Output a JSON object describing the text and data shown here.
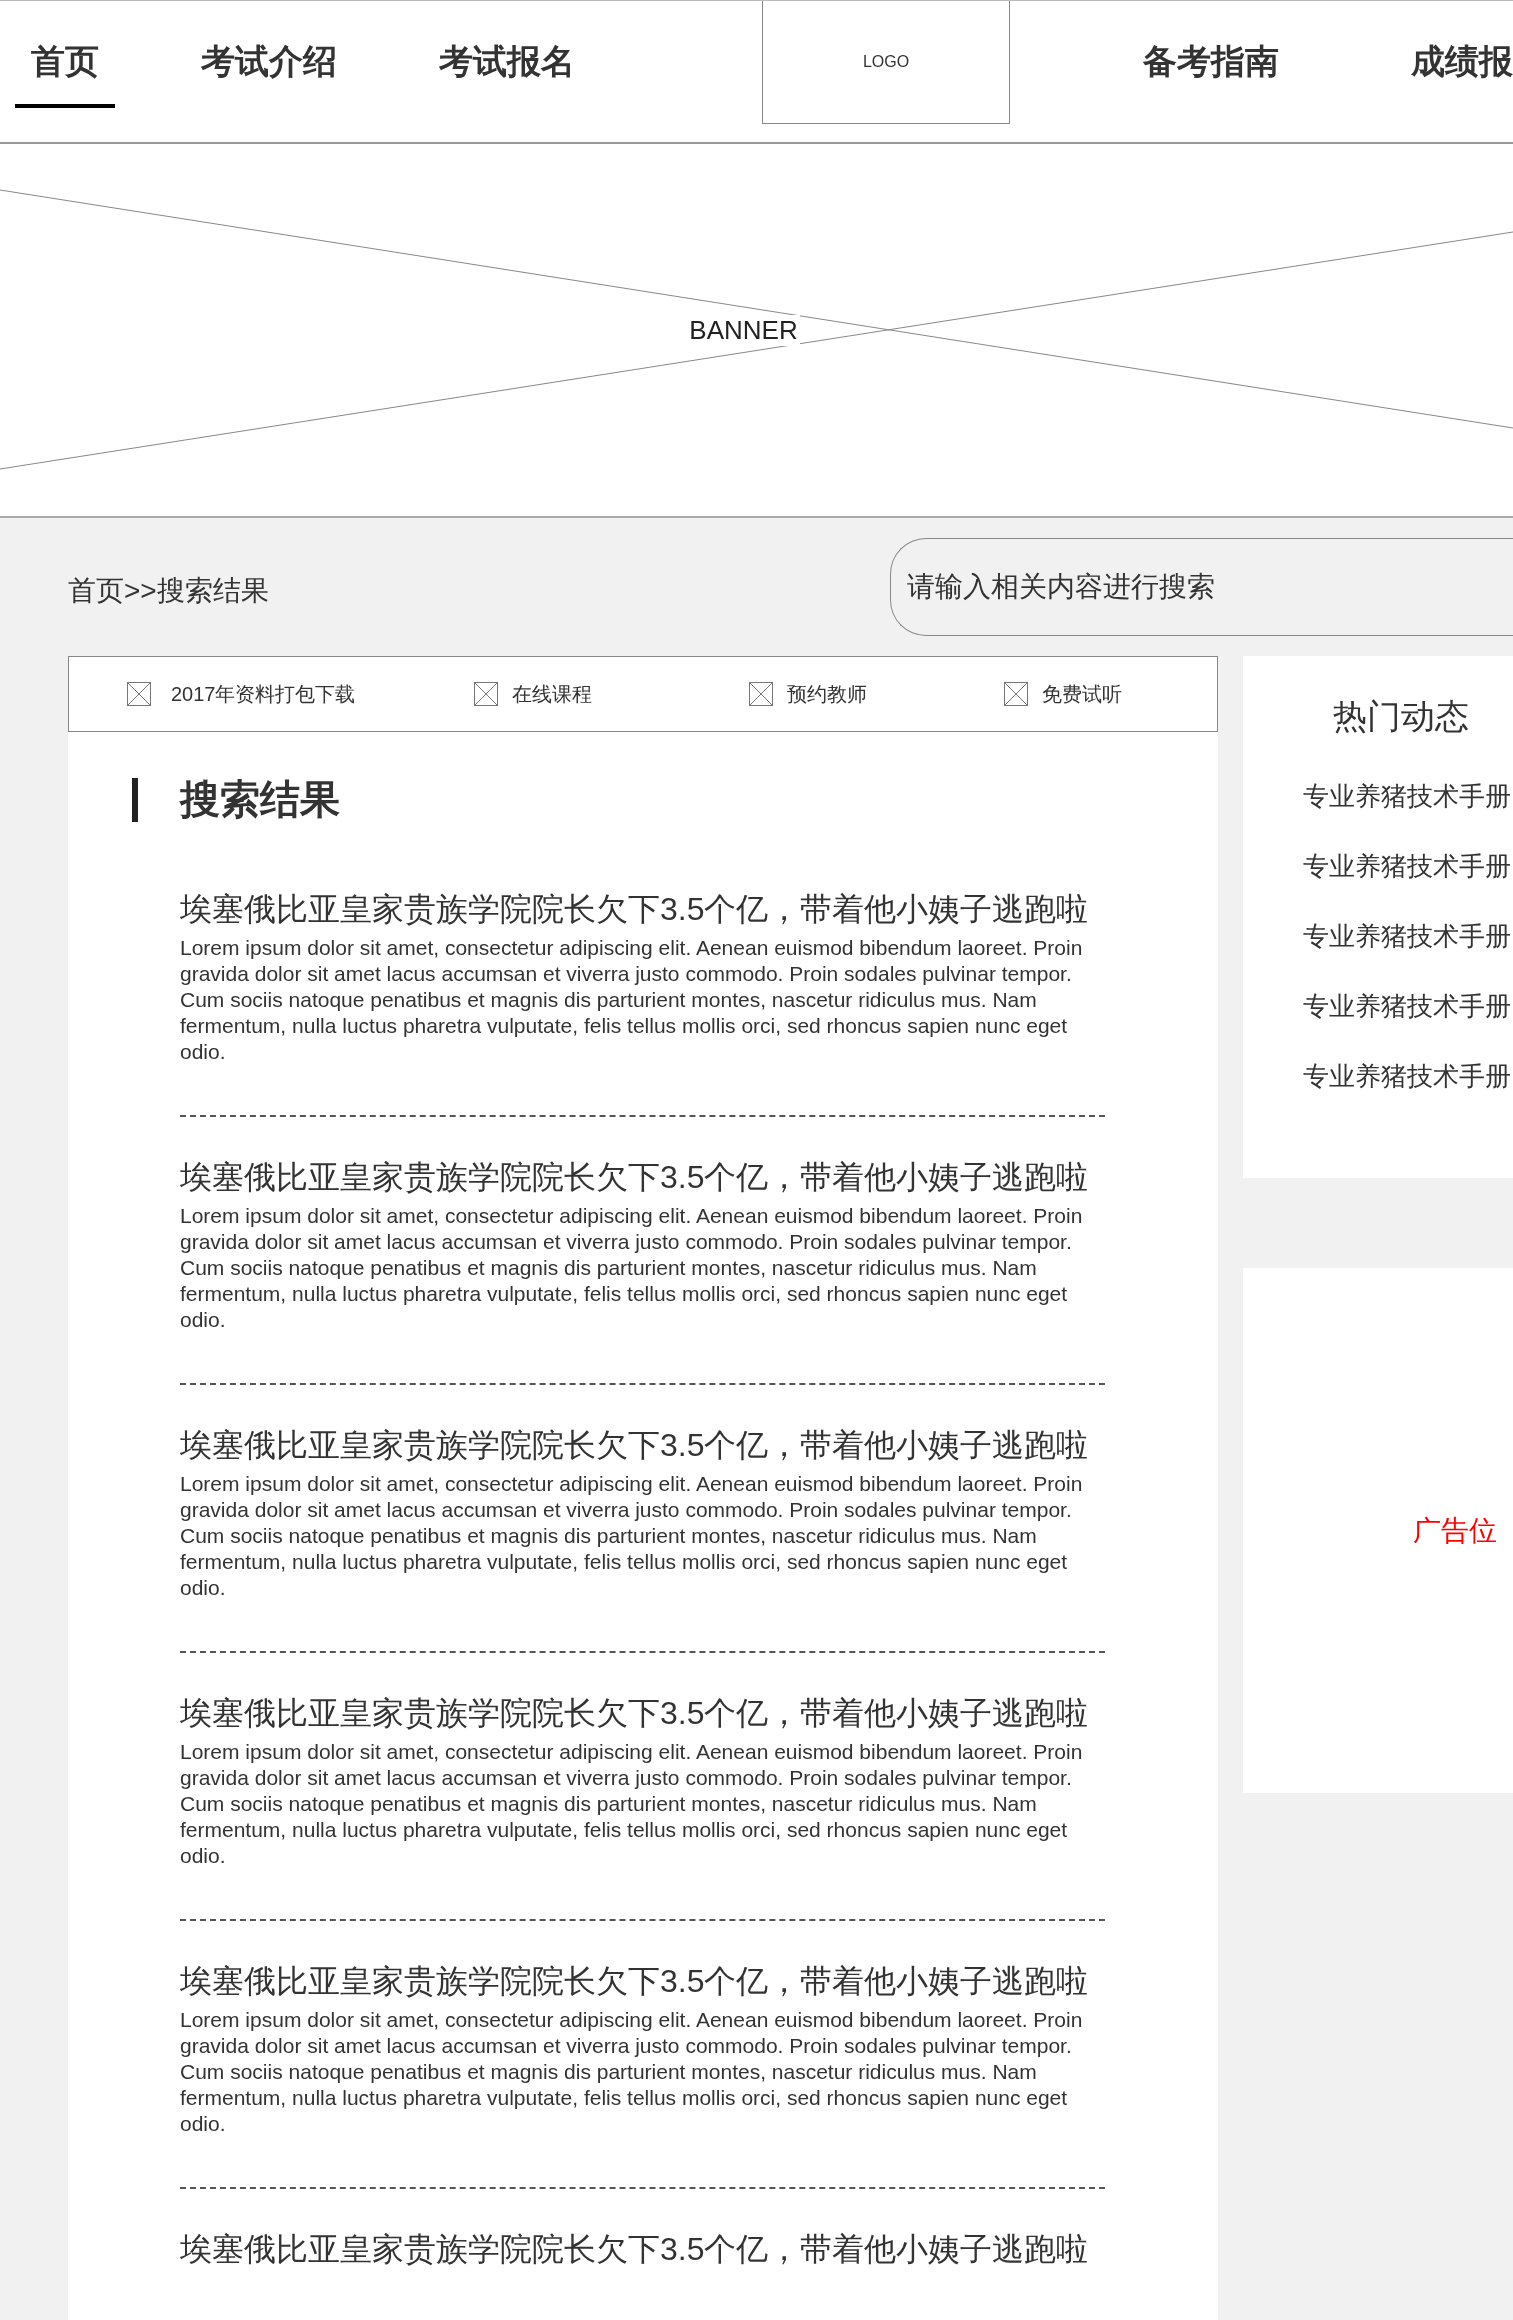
{
  "nav": {
    "left": [
      {
        "label": "首页",
        "selected": true
      },
      {
        "label": "考试介绍",
        "selected": false
      },
      {
        "label": "考试报名",
        "selected": false
      }
    ],
    "logo": "LOGO",
    "right": [
      {
        "label": "备考指南",
        "selected": false
      },
      {
        "label": "成绩报",
        "selected": false
      }
    ]
  },
  "banner": {
    "label": "BANNER"
  },
  "breadcrumb": "首页>>搜索结果",
  "search": {
    "placeholder": "请输入相关内容进行搜索"
  },
  "quick_links": [
    "2017年资料打包下载",
    "在线课程",
    "预约教师",
    "免费试听"
  ],
  "results_heading": "搜索结果",
  "results": [
    {
      "title": "埃塞俄比亚皇家贵族学院院长欠下3.5个亿，带着他小姨子逃跑啦",
      "summary": "Lorem ipsum dolor sit amet, consectetur adipiscing elit. Aenean euismod bibendum laoreet. Proin gravida dolor sit amet lacus accumsan et viverra justo commodo. Proin sodales pulvinar tempor. Cum sociis natoque penatibus et magnis dis parturient montes, nascetur ridiculus mus. Nam fermentum, nulla luctus pharetra vulputate, felis tellus mollis orci, sed rhoncus sapien nunc eget odio."
    },
    {
      "title": "埃塞俄比亚皇家贵族学院院长欠下3.5个亿，带着他小姨子逃跑啦",
      "summary": "Lorem ipsum dolor sit amet, consectetur adipiscing elit. Aenean euismod bibendum laoreet. Proin gravida dolor sit amet lacus accumsan et viverra justo commodo. Proin sodales pulvinar tempor. Cum sociis natoque penatibus et magnis dis parturient montes, nascetur ridiculus mus. Nam fermentum, nulla luctus pharetra vulputate, felis tellus mollis orci, sed rhoncus sapien nunc eget odio."
    },
    {
      "title": "埃塞俄比亚皇家贵族学院院长欠下3.5个亿，带着他小姨子逃跑啦",
      "summary": "Lorem ipsum dolor sit amet, consectetur adipiscing elit. Aenean euismod bibendum laoreet. Proin gravida dolor sit amet lacus accumsan et viverra justo commodo. Proin sodales pulvinar tempor. Cum sociis natoque penatibus et magnis dis parturient montes, nascetur ridiculus mus. Nam fermentum, nulla luctus pharetra vulputate, felis tellus mollis orci, sed rhoncus sapien nunc eget odio."
    },
    {
      "title": "埃塞俄比亚皇家贵族学院院长欠下3.5个亿，带着他小姨子逃跑啦",
      "summary": "Lorem ipsum dolor sit amet, consectetur adipiscing elit. Aenean euismod bibendum laoreet. Proin gravida dolor sit amet lacus accumsan et viverra justo commodo. Proin sodales pulvinar tempor. Cum sociis natoque penatibus et magnis dis parturient montes, nascetur ridiculus mus. Nam fermentum, nulla luctus pharetra vulputate, felis tellus mollis orci, sed rhoncus sapien nunc eget odio."
    },
    {
      "title": "埃塞俄比亚皇家贵族学院院长欠下3.5个亿，带着他小姨子逃跑啦",
      "summary": "Lorem ipsum dolor sit amet, consectetur adipiscing elit. Aenean euismod bibendum laoreet. Proin gravida dolor sit amet lacus accumsan et viverra justo commodo. Proin sodales pulvinar tempor. Cum sociis natoque penatibus et magnis dis parturient montes, nascetur ridiculus mus. Nam fermentum, nulla luctus pharetra vulputate, felis tellus mollis orci, sed rhoncus sapien nunc eget odio."
    },
    {
      "title": "埃塞俄比亚皇家贵族学院院长欠下3.5个亿，带着他小姨子逃跑啦"
    }
  ],
  "sidebar": {
    "hot_title": "热门动态",
    "hot_items": [
      "专业养猪技术手册",
      "专业养猪技术手册",
      "专业养猪技术手册",
      "专业养猪技术手册",
      "专业养猪技术手册"
    ],
    "ad_label": "广告位"
  }
}
